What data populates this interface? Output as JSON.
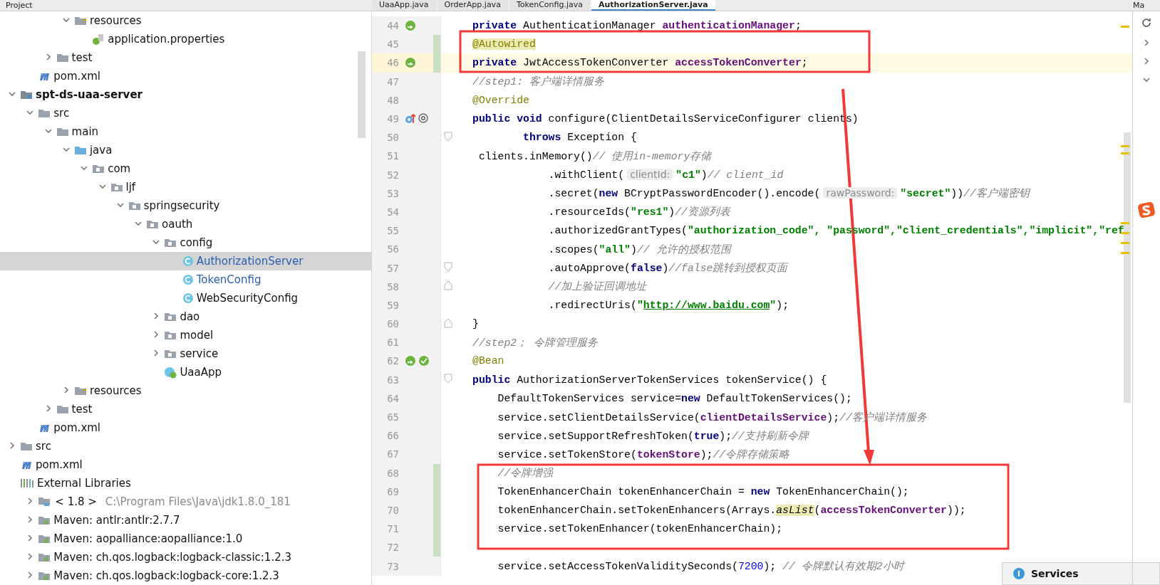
{
  "header": {
    "panel_title": "Project",
    "tabs": [
      {
        "label": "UaaApp.java",
        "selected": false
      },
      {
        "label": "OrderApp.java",
        "selected": false
      },
      {
        "label": "TokenConfig.java",
        "selected": false
      },
      {
        "label": "AuthorizationServer.java",
        "selected": true
      }
    ],
    "side_label": "Ma"
  },
  "tree": [
    {
      "children": [
        {
          "children": [
            {
              "children": [
                {
                  "label": "resources",
                  "kind": "resources-folder",
                  "expanded": true,
                  "selected": false,
                  "children": [
                    {
                      "label": "application.properties",
                      "kind": "properties",
                      "selected": false
                    }
                  ]
                }
              ]
            },
            {
              "label": "test",
              "kind": "folder",
              "expanded": false,
              "selected": false
            }
          ]
        },
        {
          "label": "pom.xml",
          "kind": "maven",
          "selected": false
        }
      ]
    },
    {
      "label": "spt-ds-uaa-server",
      "kind": "module",
      "expanded": true,
      "selected": false,
      "children": [
        {
          "label": "src",
          "kind": "folder",
          "expanded": true,
          "selected": false,
          "children": [
            {
              "label": "main",
              "kind": "folder",
              "expanded": true,
              "selected": false,
              "children": [
                {
                  "label": "java",
                  "kind": "source-folder",
                  "expanded": true,
                  "selected": false,
                  "children": [
                    {
                      "label": "com",
                      "kind": "package",
                      "expanded": true,
                      "selected": false,
                      "children": [
                        {
                          "label": "ljf",
                          "kind": "package",
                          "expanded": true,
                          "selected": false,
                          "children": [
                            {
                              "label": "springsecurity",
                              "kind": "package",
                              "expanded": true,
                              "selected": false,
                              "children": [
                                {
                                  "label": "oauth",
                                  "kind": "package",
                                  "expanded": true,
                                  "selected": false,
                                  "children": [
                                    {
                                      "label": "config",
                                      "kind": "package",
                                      "expanded": true,
                                      "selected": false,
                                      "children": [
                                        {
                                          "label": "AuthorizationServer",
                                          "kind": "class",
                                          "modified": true,
                                          "selected": true
                                        },
                                        {
                                          "label": "TokenConfig",
                                          "kind": "class",
                                          "modified": true,
                                          "selected": false
                                        },
                                        {
                                          "label": "WebSecurityConfig",
                                          "kind": "class",
                                          "modified": false,
                                          "selected": false
                                        }
                                      ]
                                    },
                                    {
                                      "label": "dao",
                                      "kind": "package",
                                      "expanded": false,
                                      "selected": false
                                    },
                                    {
                                      "label": "model",
                                      "kind": "package",
                                      "expanded": false,
                                      "selected": false
                                    },
                                    {
                                      "label": "service",
                                      "kind": "package",
                                      "expanded": false,
                                      "selected": false
                                    },
                                    {
                                      "label": "UaaApp",
                                      "kind": "spring-class",
                                      "selected": false
                                    }
                                  ]
                                }
                              ]
                            }
                          ]
                        }
                      ]
                    }
                  ]
                },
                {
                  "label": "resources",
                  "kind": "resources-folder",
                  "expanded": false,
                  "selected": false
                }
              ]
            },
            {
              "label": "test",
              "kind": "folder",
              "expanded": false,
              "selected": false
            }
          ]
        },
        {
          "label": "pom.xml",
          "kind": "maven",
          "selected": false
        }
      ]
    },
    {
      "label": "src",
      "kind": "folder",
      "expanded": false,
      "selected": false
    },
    {
      "label": "pom.xml",
      "kind": "maven",
      "selected": false
    },
    {
      "label": "External Libraries",
      "kind": "libraries",
      "selected": false,
      "children": [
        {
          "label": "< 1.8 >",
          "detail": "C:\\Program Files\\Java\\jdk1.8.0_181",
          "kind": "jdk",
          "expanded": false,
          "selected": false
        },
        {
          "label": "Maven: antlr:antlr:2.7.7",
          "kind": "library",
          "expanded": false,
          "selected": false
        },
        {
          "label": "Maven: aopalliance:aopalliance:1.0",
          "kind": "library",
          "expanded": false,
          "selected": false
        },
        {
          "label": "Maven: ch.qos.logback:logback-classic:1.2.3",
          "kind": "library",
          "expanded": false,
          "selected": false
        },
        {
          "label": "Maven: ch.qos.logback:logback-core:1.2.3",
          "kind": "library",
          "expanded": false,
          "selected": false
        }
      ]
    }
  ],
  "editor": {
    "lines": [
      {
        "number": "44",
        "gutter": [
          {
            "kind": "bean"
          }
        ],
        "tokens": [
          {
            "kind": "keyword",
            "text": "private"
          },
          {
            "kind": "plain",
            "text": " AuthenticationManager "
          },
          {
            "kind": "field",
            "text": "authenticationManager"
          },
          {
            "kind": "plain",
            "text": ";"
          }
        ]
      },
      {
        "number": "45",
        "changed": true,
        "tokens": [
          {
            "kind": "annotation",
            "text": "@Autowired",
            "highlight": true
          }
        ]
      },
      {
        "number": "46",
        "current": true,
        "changed": true,
        "gutter": [
          {
            "kind": "bean"
          }
        ],
        "tokens": [
          {
            "kind": "keyword",
            "text": "private"
          },
          {
            "kind": "plain",
            "text": " JwtAccessTokenConverter "
          },
          {
            "kind": "field",
            "text": "accessTokenConverter"
          },
          {
            "kind": "plain",
            "text": ";"
          }
        ]
      },
      {
        "number": "47",
        "tokens": [
          {
            "kind": "comment",
            "text": "//step1: 客户端详情服务"
          }
        ]
      },
      {
        "number": "48",
        "tokens": [
          {
            "kind": "annotation",
            "text": "@Override"
          }
        ]
      },
      {
        "number": "49",
        "gutter": [
          {
            "kind": "override"
          },
          {
            "kind": "at"
          }
        ],
        "tokens": [
          {
            "kind": "keyword",
            "text": "public void"
          },
          {
            "kind": "plain",
            "text": " configure(ClientDetailsServiceConfigurer clients)"
          }
        ]
      },
      {
        "number": "50",
        "fold": {
          "kind": "open"
        },
        "tokens": [
          {
            "kind": "keyword",
            "text": "        throws"
          },
          {
            "kind": "plain",
            "text": " Exception {"
          }
        ]
      },
      {
        "number": "51",
        "tokens": [
          {
            "kind": "plain",
            "text": " clients.inMemory()"
          },
          {
            "kind": "comment",
            "text": "// 使用in-memory存储"
          }
        ]
      },
      {
        "number": "52",
        "tokens": [
          {
            "kind": "plain",
            "text": "            .withClient("
          },
          {
            "kind": "hint",
            "text": "clientId:"
          },
          {
            "kind": "string",
            "text": "\"c1\""
          },
          {
            "kind": "plain",
            "text": ")"
          },
          {
            "kind": "comment",
            "text": "// client_id"
          }
        ]
      },
      {
        "number": "53",
        "tokens": [
          {
            "kind": "plain",
            "text": "            .secret("
          },
          {
            "kind": "keyword",
            "text": "new"
          },
          {
            "kind": "plain",
            "text": " BCryptPasswordEncoder().encode("
          },
          {
            "kind": "hint",
            "text": "rawPassword:"
          },
          {
            "kind": "string",
            "text": "\"secret\""
          },
          {
            "kind": "plain",
            "text": "))"
          },
          {
            "kind": "comment",
            "text": "//客户端密钥"
          }
        ]
      },
      {
        "number": "54",
        "tokens": [
          {
            "kind": "plain",
            "text": "            .resourceIds("
          },
          {
            "kind": "string",
            "text": "\"res1\""
          },
          {
            "kind": "plain",
            "text": ")"
          },
          {
            "kind": "comment",
            "text": "//资源列表"
          }
        ]
      },
      {
        "number": "55",
        "tokens": [
          {
            "kind": "plain",
            "text": "            .authorizedGrantTypes("
          },
          {
            "kind": "string",
            "text": "\"authorization_code\", "
          },
          {
            "kind": "string",
            "text": "\"password\","
          },
          {
            "kind": "string",
            "text": "\"client_credentials\","
          },
          {
            "kind": "string",
            "text": "\"implicit\","
          },
          {
            "kind": "string",
            "text": "\"ref"
          }
        ]
      },
      {
        "number": "56",
        "tokens": [
          {
            "kind": "plain",
            "text": "            .scopes("
          },
          {
            "kind": "string",
            "text": "\"all\""
          },
          {
            "kind": "plain",
            "text": ")"
          },
          {
            "kind": "comment",
            "text": "// 允许的授权范围"
          }
        ]
      },
      {
        "number": "57",
        "fold": {
          "kind": "open"
        },
        "tokens": [
          {
            "kind": "plain",
            "text": "            .autoApprove("
          },
          {
            "kind": "keyword",
            "text": "false"
          },
          {
            "kind": "plain",
            "text": ")"
          },
          {
            "kind": "comment",
            "text": "//false跳转到授权页面"
          }
        ]
      },
      {
        "number": "58",
        "fold": {
          "kind": "close"
        },
        "tokens": [
          {
            "kind": "comment",
            "text": "            //加上验证回调地址"
          }
        ]
      },
      {
        "number": "59",
        "tokens": [
          {
            "kind": "plain",
            "text": "            .redirectUris("
          },
          {
            "kind": "string",
            "text": "\""
          },
          {
            "kind": "link",
            "text": "http://www.baidu.com"
          },
          {
            "kind": "string",
            "text": "\""
          },
          {
            "kind": "plain",
            "text": ");"
          }
        ]
      },
      {
        "number": "60",
        "fold": {
          "kind": "close"
        },
        "tokens": [
          {
            "kind": "plain",
            "text": "}"
          }
        ]
      },
      {
        "number": "61",
        "tokens": [
          {
            "kind": "comment",
            "text": "//step2； 令牌管理服务"
          }
        ]
      },
      {
        "number": "62",
        "gutter": [
          {
            "kind": "bean"
          },
          {
            "kind": "bean-check"
          }
        ],
        "tokens": [
          {
            "kind": "annotation",
            "text": "@Bean"
          }
        ]
      },
      {
        "number": "63",
        "fold": {
          "kind": "open"
        },
        "tokens": [
          {
            "kind": "keyword",
            "text": "public"
          },
          {
            "kind": "plain",
            "text": " AuthorizationServerTokenServices tokenService() {"
          }
        ]
      },
      {
        "number": "64",
        "tokens": [
          {
            "kind": "plain",
            "text": "    DefaultTokenServices service="
          },
          {
            "kind": "keyword",
            "text": "new"
          },
          {
            "kind": "plain",
            "text": " DefaultTokenServices();"
          }
        ]
      },
      {
        "number": "65",
        "tokens": [
          {
            "kind": "plain",
            "text": "    service.setClientDetailsService("
          },
          {
            "kind": "field",
            "text": "clientDetailsService"
          },
          {
            "kind": "plain",
            "text": ");"
          },
          {
            "kind": "comment",
            "text": "//客户端详情服务"
          }
        ]
      },
      {
        "number": "66",
        "tokens": [
          {
            "kind": "plain",
            "text": "    service.setSupportRefreshToken("
          },
          {
            "kind": "keyword",
            "text": "true"
          },
          {
            "kind": "plain",
            "text": ");"
          },
          {
            "kind": "comment",
            "text": "//支持刷新令牌"
          }
        ]
      },
      {
        "number": "67",
        "tokens": [
          {
            "kind": "plain",
            "text": "    service.setTokenStore("
          },
          {
            "kind": "field",
            "text": "tokenStore"
          },
          {
            "kind": "plain",
            "text": ");"
          },
          {
            "kind": "comment",
            "text": "//令牌存储策略"
          }
        ]
      },
      {
        "number": "68",
        "changed": true,
        "tokens": [
          {
            "kind": "comment",
            "text": "    //令牌增强"
          }
        ]
      },
      {
        "number": "69",
        "changed": true,
        "tokens": [
          {
            "kind": "plain",
            "text": "    TokenEnhancerChain tokenEnhancerChain = "
          },
          {
            "kind": "keyword",
            "text": "new"
          },
          {
            "kind": "plain",
            "text": " TokenEnhancerChain();"
          }
        ]
      },
      {
        "number": "70",
        "changed": true,
        "tokens": [
          {
            "kind": "plain",
            "text": "    tokenEnhancerChain.setTokenEnhancers(Arrays."
          },
          {
            "kind": "static",
            "text": "asList",
            "highlight": true
          },
          {
            "kind": "plain",
            "text": "("
          },
          {
            "kind": "field",
            "text": "accessTokenConverter"
          },
          {
            "kind": "plain",
            "text": "));"
          }
        ]
      },
      {
        "number": "71",
        "changed": true,
        "tokens": [
          {
            "kind": "plain",
            "text": "    service.setTokenEnhancer(tokenEnhancerChain);"
          }
        ]
      },
      {
        "number": "72",
        "changed": true
      },
      {
        "number": "73",
        "tokens": [
          {
            "kind": "plain",
            "text": "    service.setAccessTokenValiditySeconds("
          },
          {
            "kind": "number",
            "text": "7200"
          },
          {
            "kind": "plain",
            "text": "); "
          },
          {
            "kind": "comment",
            "text": "// 令牌默认有效期2小时"
          }
        ]
      }
    ]
  },
  "services_popup": {
    "label": "Services"
  }
}
